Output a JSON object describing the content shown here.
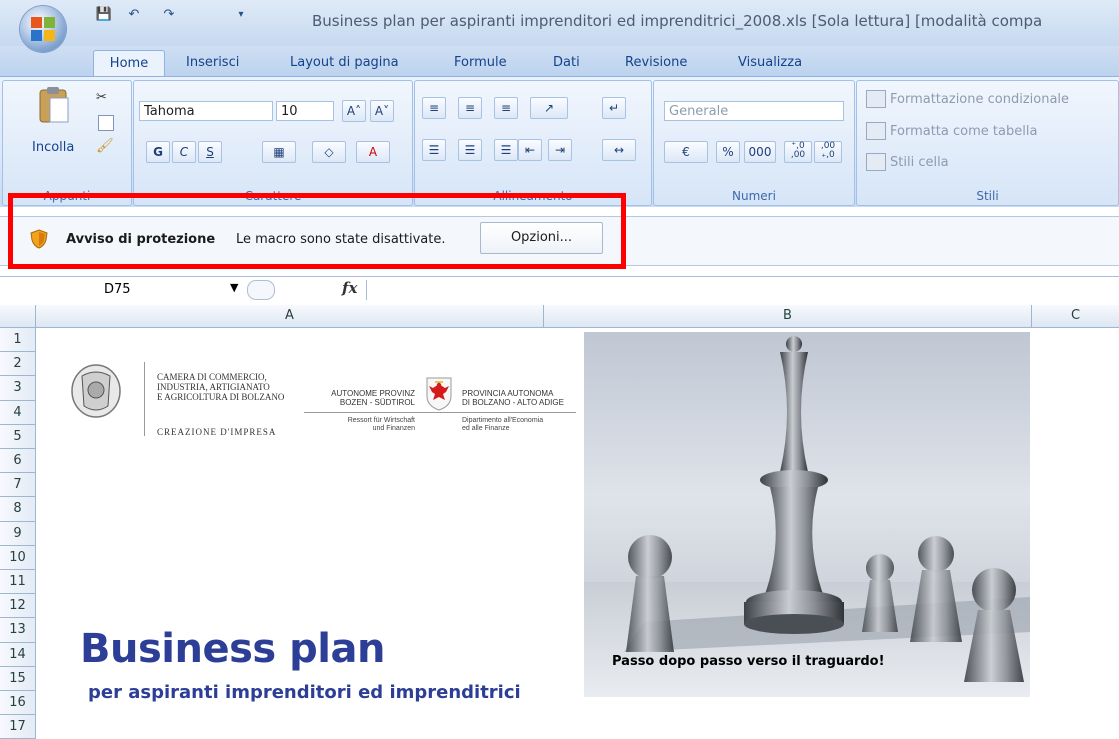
{
  "window": {
    "title": "Business plan per aspiranti imprenditori ed imprenditrici_2008.xls  [Sola lettura]  [modalità compa"
  },
  "tabs": [
    "Home",
    "Inserisci",
    "Layout di pagina",
    "Formule",
    "Dati",
    "Revisione",
    "Visualizza"
  ],
  "ribbon": {
    "clipboard": {
      "label": "Appunti",
      "paste_label": "Incolla"
    },
    "font": {
      "label": "Carattere",
      "font_name": "Tahoma",
      "font_size": "10",
      "bold": "G",
      "italic": "C",
      "underline": "S"
    },
    "alignment": {
      "label": "Allineamento"
    },
    "number": {
      "label": "Numeri",
      "format": "Generale",
      "percent": "%",
      "thousands": "000",
      "inc_decimal": "⁺,0\n,00",
      "dec_decimal": ",00\n₊,0"
    },
    "styles": {
      "label": "Stili",
      "conditional": "Formattazione condizionale",
      "as_table": "Formatta come tabella",
      "cell_styles": "Stili cella"
    }
  },
  "security_bar": {
    "title": "Avviso di protezione",
    "message": "Le macro sono state disattivate.",
    "options_label": "Opzioni..."
  },
  "formula_bar": {
    "name_box": "D75",
    "fx": "fx"
  },
  "columns": [
    "A",
    "B",
    "C"
  ],
  "rows": [
    "1",
    "2",
    "3",
    "4",
    "5",
    "6",
    "7",
    "8",
    "9",
    "10",
    "11",
    "12",
    "13",
    "14",
    "15",
    "16",
    "17"
  ],
  "sheet": {
    "cciaa_lines": "CAMERA DI COMMERCIO,\nINDUSTRIA, ARTIGIANATO\nE AGRICOLTURA DI BOLZANO",
    "creazione": "CREAZIONE D'IMPRESA",
    "province_de": "AUTONOME PROVINZ\nBOZEN - SÜDTIROL",
    "province_it": "PROVINCIA AUTONOMA\nDI BOLZANO - ALTO ADIGE",
    "ressort": "Ressort für Wirtschaft\nund Finanzen",
    "dipartimento": "Dipartimento all'Economia\ned alle Finanze",
    "title": "Business plan",
    "subtitle": "per aspiranti imprenditori ed imprenditrici",
    "photo_caption": "Passo dopo passo verso il traguardo!"
  },
  "colors": {
    "accent_blue": "#2c3e96",
    "highlight_red": "#ff0000",
    "ribbon_text": "#15428b"
  }
}
